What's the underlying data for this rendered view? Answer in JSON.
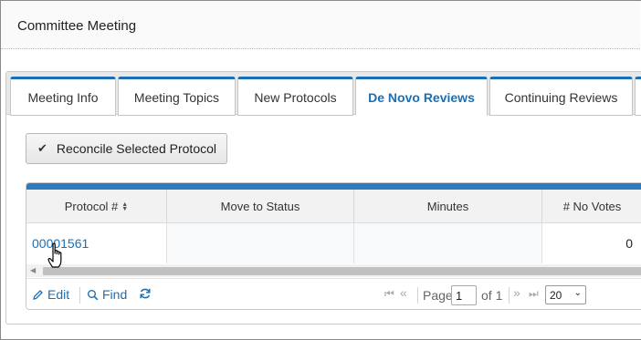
{
  "page": {
    "title": "Committee Meeting"
  },
  "tabs": [
    {
      "label": "Meeting Info",
      "active": false
    },
    {
      "label": "Meeting Topics",
      "active": false
    },
    {
      "label": "New Protocols",
      "active": false
    },
    {
      "label": "De Novo Reviews",
      "active": true
    },
    {
      "label": "Continuing Reviews",
      "active": false
    }
  ],
  "toolbar": {
    "reconcile_label": "Reconcile Selected Protocol",
    "reconcile_icon": "check-icon"
  },
  "grid": {
    "accent_color": "#2d7bc0",
    "columns": [
      "Protocol #",
      "Move to Status",
      "Minutes",
      "# No Votes"
    ],
    "rows": [
      {
        "protocol": "00001561",
        "move_to_status": "",
        "minutes": "",
        "no_votes": "0"
      }
    ]
  },
  "pager": {
    "edit_label": "Edit",
    "find_label": "Find",
    "page_label": "Page",
    "page_value": "1",
    "of_label": "of 1",
    "rows_per_page": "20"
  },
  "colors": {
    "link": "#1a6fb5",
    "tab_accent": "#1a6fb5"
  }
}
